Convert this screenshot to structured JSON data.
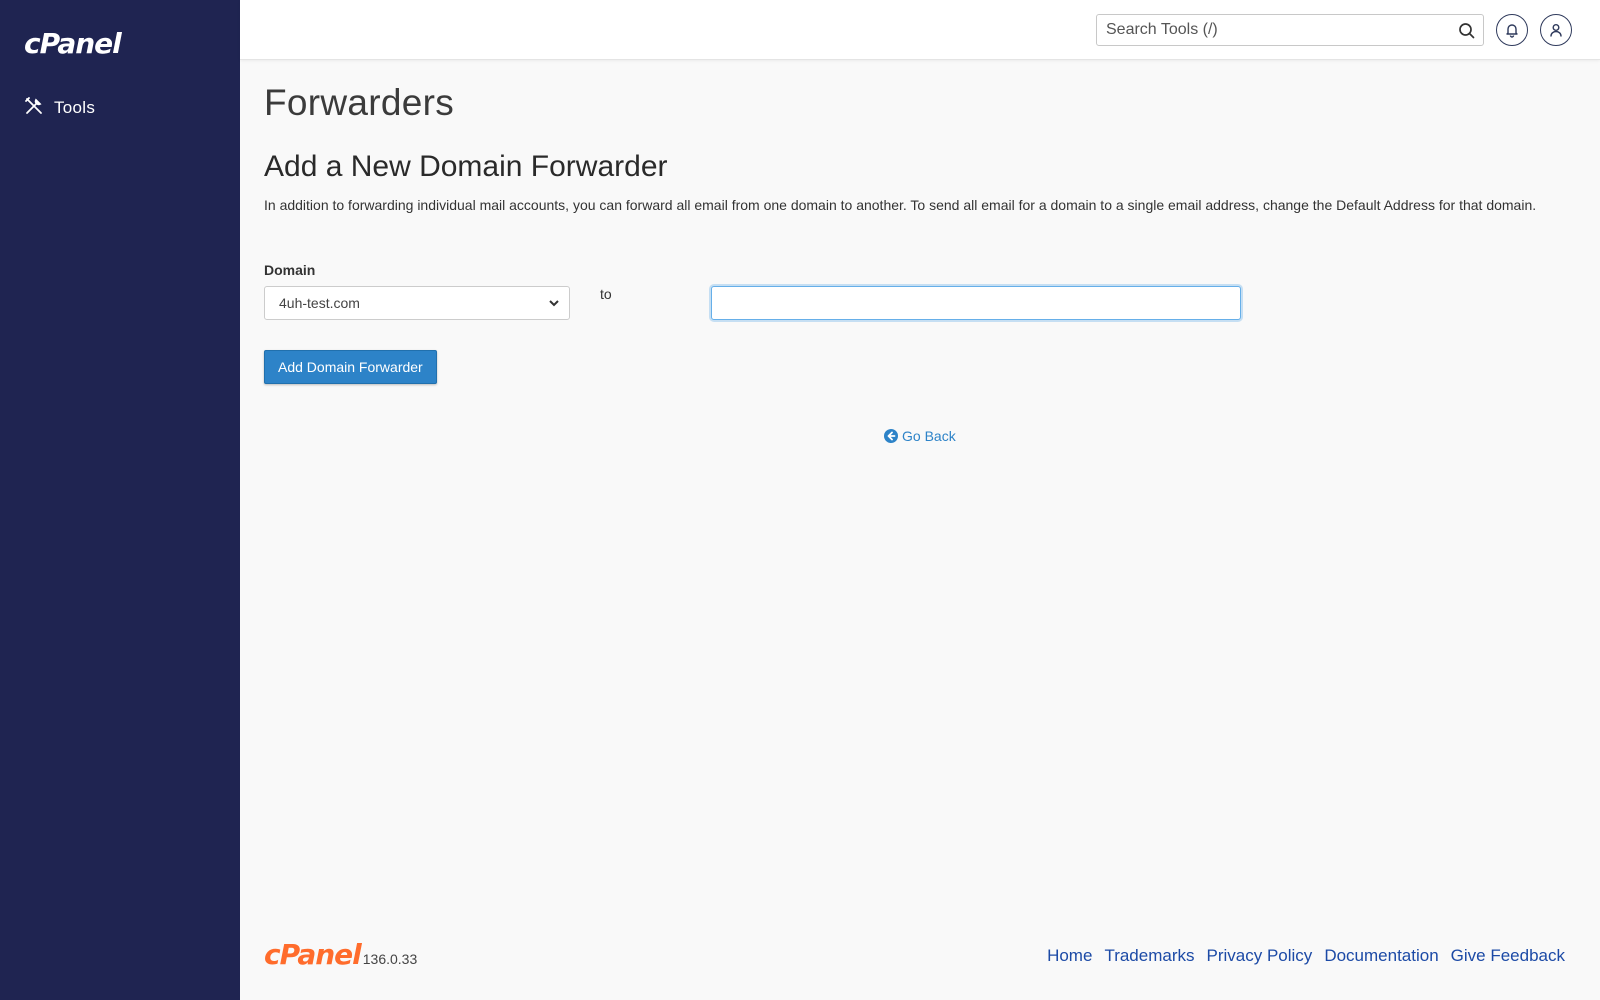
{
  "sidebar": {
    "logo_text": "cPanel",
    "nav_items": [
      {
        "label": "Tools",
        "icon": "tools-icon"
      }
    ]
  },
  "topbar": {
    "search_placeholder": "Search Tools (/)",
    "search_value": ""
  },
  "main": {
    "page_title": "Forwarders",
    "section_title": "Add a New Domain Forwarder",
    "description": "In addition to forwarding individual mail accounts, you can forward all email from one domain to another. To send all email for a domain to a single email address, change the Default Address for that domain.",
    "domain_label": "Domain",
    "domain_selected": "4uh-test.com",
    "to_label": "to",
    "target_value": "",
    "add_button_label": "Add Domain Forwarder",
    "go_back_label": "Go Back"
  },
  "footer": {
    "brand": "cPanel",
    "version": "136.0.33",
    "links": [
      "Home",
      "Trademarks",
      "Privacy Policy",
      "Documentation",
      "Give Feedback"
    ]
  },
  "colors": {
    "sidebar_bg": "#1f2451",
    "primary_button": "#2d83c8",
    "brand_orange": "#ff6c2c",
    "footer_link": "#1c4aa6"
  }
}
